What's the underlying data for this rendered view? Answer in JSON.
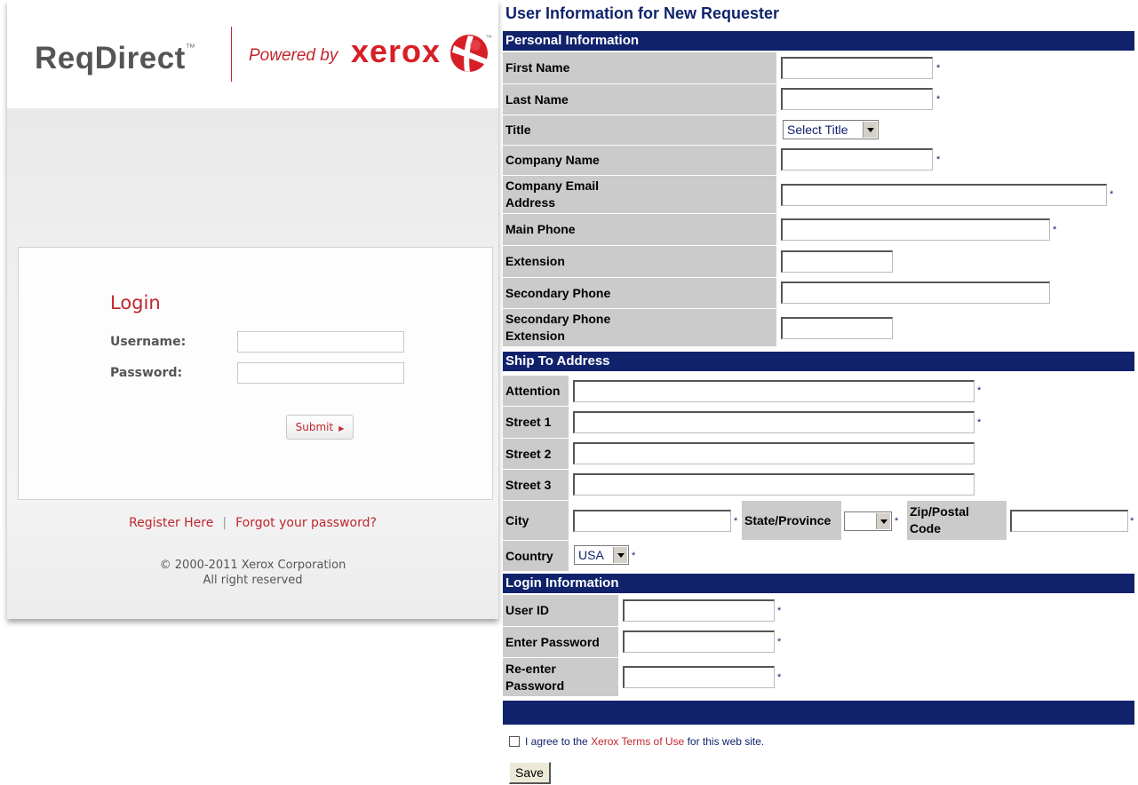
{
  "login_panel": {
    "brand": "ReqDirect",
    "brand_tm": "™",
    "powered_by": "Powered by",
    "xerox": "xerox",
    "xerox_tm": "™",
    "login_title": "Login",
    "username_label": "Username:",
    "password_label": "Password:",
    "submit_label": "Submit",
    "register_link": "Register Here",
    "separator": "|",
    "forgot_link": "Forgot your password?",
    "copyright_line1": "© 2000-2011 Xerox Corporation",
    "copyright_line2": "All right reserved"
  },
  "form": {
    "title": "User Information for New Requester",
    "required_mark": "*",
    "sections": {
      "personal": "Personal Information",
      "ship": "Ship To Address",
      "login": "Login Information"
    },
    "personal_fields": {
      "first_name": "First Name",
      "last_name": "Last Name",
      "title": "Title",
      "title_select": "Select Title",
      "company_name": "Company Name",
      "company_email_1": "Company Email",
      "company_email_2": "Address",
      "main_phone": "Main Phone",
      "extension": "Extension",
      "secondary_phone": "Secondary Phone",
      "secondary_ext_1": "Secondary Phone",
      "secondary_ext_2": "Extension"
    },
    "ship_fields": {
      "attention": "Attention",
      "street1": "Street 1",
      "street2": "Street 2",
      "street3": "Street 3",
      "city": "City",
      "state": "State/Province",
      "state_select": "",
      "zip_1": "Zip/Postal",
      "zip_2": "Code",
      "country": "Country",
      "country_select": "USA"
    },
    "login_fields": {
      "user_id": "User ID",
      "enter_password": "Enter Password",
      "reenter_1": "Re-enter",
      "reenter_2": "Password"
    },
    "agree_prefix": "I agree to the",
    "agree_link": "Xerox Terms of Use",
    "agree_suffix": "for this web site.",
    "save_label": "Save"
  },
  "colors": {
    "xerox_red": "#c0262d",
    "form_navy": "#10226c",
    "label_gray": "#cbcbcb"
  }
}
